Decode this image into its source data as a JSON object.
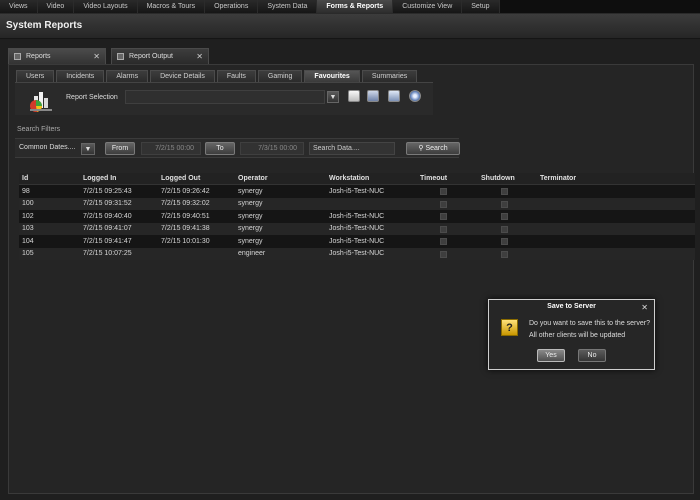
{
  "nav": {
    "items": [
      {
        "label": "Views",
        "active": false
      },
      {
        "label": "Video",
        "active": false
      },
      {
        "label": "Video Layouts",
        "active": false
      },
      {
        "label": "Macros & Tours",
        "active": false
      },
      {
        "label": "Operations",
        "active": false
      },
      {
        "label": "System Data",
        "active": false
      },
      {
        "label": "Forms & Reports",
        "active": true
      },
      {
        "label": "Customize View",
        "active": false
      },
      {
        "label": "Setup",
        "active": false
      }
    ]
  },
  "page": {
    "title": "System Reports"
  },
  "doc_tabs": [
    {
      "label": "Reports",
      "active": true
    },
    {
      "label": "Report Output",
      "active": false
    }
  ],
  "sub_tabs": [
    {
      "label": "Users",
      "active": false
    },
    {
      "label": "Incidents",
      "active": false
    },
    {
      "label": "Alarms",
      "active": false
    },
    {
      "label": "Device Details",
      "active": false
    },
    {
      "label": "Faults",
      "active": false
    },
    {
      "label": "Gaming",
      "active": false
    },
    {
      "label": "Favourites",
      "active": true
    },
    {
      "label": "Summaries",
      "active": false
    }
  ],
  "report": {
    "selection_label": "Report Selection",
    "selection_value": ""
  },
  "filters": {
    "section_label": "Search Filters",
    "common_dates": "Common Dates....",
    "from_label": "From",
    "from_value": "7/2/15 00:00",
    "to_label": "To",
    "to_value": "7/3/15 00:00",
    "search_placeholder": "Search Data....",
    "search_label": "Search"
  },
  "table": {
    "columns": [
      "Id",
      "Logged In",
      "Logged Out",
      "Operator",
      "Workstation",
      "Timeout",
      "Shutdown",
      "Terminator"
    ],
    "rows": [
      {
        "id": "98",
        "logged_in": "7/2/15 09:25:43",
        "logged_out": "7/2/15 09:26:42",
        "operator": "synergy",
        "workstation": "Josh-i5-Test-NUC"
      },
      {
        "id": "100",
        "logged_in": "7/2/15 09:31:52",
        "logged_out": "7/2/15 09:32:02",
        "operator": "synergy",
        "workstation": ""
      },
      {
        "id": "102",
        "logged_in": "7/2/15 09:40:40",
        "logged_out": "7/2/15 09:40:51",
        "operator": "synergy",
        "workstation": "Josh-i5-Test-NUC"
      },
      {
        "id": "103",
        "logged_in": "7/2/15 09:41:07",
        "logged_out": "7/2/15 09:41:38",
        "operator": "synergy",
        "workstation": "Josh-i5-Test-NUC"
      },
      {
        "id": "104",
        "logged_in": "7/2/15 09:41:47",
        "logged_out": "7/2/15 10:01:30",
        "operator": "synergy",
        "workstation": "Josh-i5-Test-NUC"
      },
      {
        "id": "105",
        "logged_in": "7/2/15 10:07:25",
        "logged_out": "",
        "operator": "engineer",
        "workstation": "Josh-i5-Test-NUC"
      }
    ]
  },
  "dialog": {
    "title": "Save to Server",
    "message_line1": "Do you want to save this to the server?",
    "message_line2": "All other clients will be updated",
    "yes_label": "Yes",
    "no_label": "No",
    "icon": "question-icon"
  },
  "colors": {
    "background": "#1e1e1e",
    "panel": "#252525",
    "row_dark": "#151515",
    "row_light": "#262626",
    "dialog_border": "#cfcfcf",
    "question_icon": "#e8b800"
  }
}
